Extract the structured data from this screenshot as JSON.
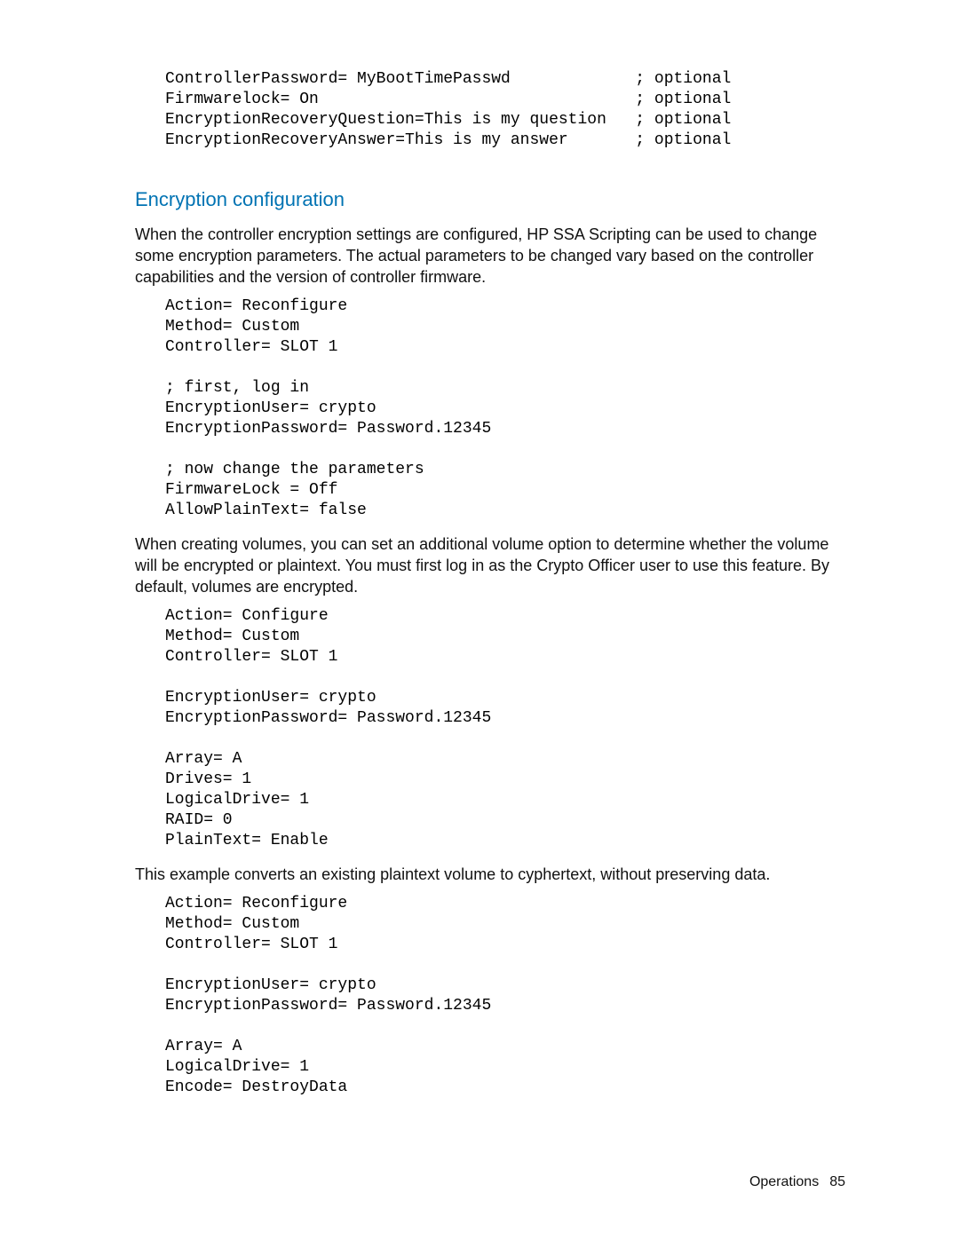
{
  "codeblocks": {
    "intro": "ControllerPassword= MyBootTimePasswd             ; optional\nFirmwarelock= On                                 ; optional\nEncryptionRecoveryQuestion=This is my question   ; optional\nEncryptionRecoveryAnswer=This is my answer       ; optional",
    "reconfigure_example": "Action= Reconfigure\nMethod= Custom\nController= SLOT 1\n\n; first, log in\nEncryptionUser= crypto\nEncryptionPassword= Password.12345\n\n; now change the parameters\nFirmwareLock = Off\nAllowPlainText= false",
    "configure_example": "Action= Configure\nMethod= Custom\nController= SLOT 1\n\nEncryptionUser= crypto\nEncryptionPassword= Password.12345\n\nArray= A\nDrives= 1\nLogicalDrive= 1\nRAID= 0\nPlainText= Enable",
    "convert_example": "Action= Reconfigure\nMethod= Custom\nController= SLOT 1\n\nEncryptionUser= crypto\nEncryptionPassword= Password.12345\n\nArray= A\nLogicalDrive= 1\nEncode= DestroyData"
  },
  "section": {
    "heading": "Encryption configuration",
    "para1": "When the controller encryption settings are configured, HP SSA Scripting can be used to change some encryption parameters. The actual parameters to be changed vary based on the controller capabilities and the version of controller firmware.",
    "para2": "When creating volumes, you can set an additional volume option to determine whether the volume will be encrypted or plaintext. You must first log in as the Crypto Officer user to use this feature. By default, volumes are encrypted.",
    "para3": "This example converts an existing plaintext volume to cyphertext, without preserving data."
  },
  "footer": {
    "label": "Operations",
    "page": "85"
  }
}
